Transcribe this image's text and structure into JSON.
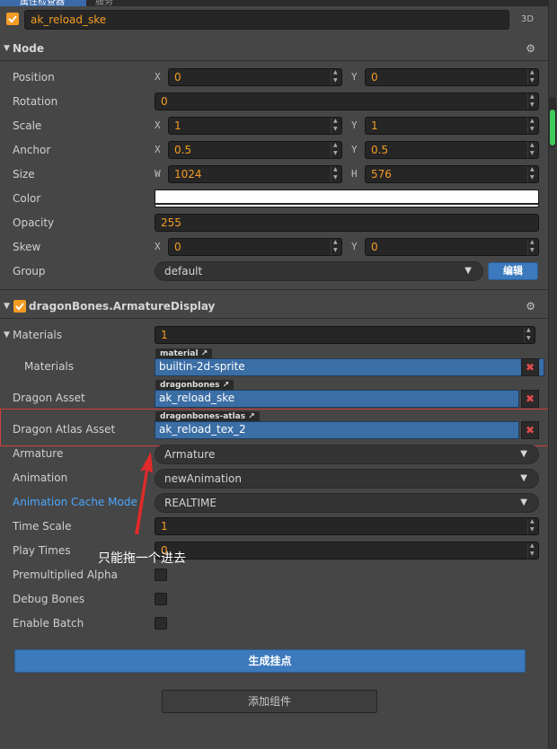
{
  "tabs": {
    "properties": "属性检查器",
    "other": "服务"
  },
  "node_name": "ak_reload_ske",
  "label_3d": "3D",
  "node_section": {
    "title": "Node",
    "position": {
      "label": "Position",
      "x_axis": "X",
      "x": "0",
      "y_axis": "Y",
      "y": "0"
    },
    "rotation": {
      "label": "Rotation",
      "value": "0"
    },
    "scale": {
      "label": "Scale",
      "x_axis": "X",
      "x": "1",
      "y_axis": "Y",
      "y": "1"
    },
    "anchor": {
      "label": "Anchor",
      "x_axis": "X",
      "x": "0.5",
      "y_axis": "Y",
      "y": "0.5"
    },
    "size": {
      "label": "Size",
      "w_axis": "W",
      "w": "1024",
      "h_axis": "H",
      "h": "576"
    },
    "color": {
      "label": "Color",
      "value": "#ffffff"
    },
    "opacity": {
      "label": "Opacity",
      "value": "255"
    },
    "skew": {
      "label": "Skew",
      "x_axis": "X",
      "x": "0",
      "y_axis": "Y",
      "y": "0"
    },
    "group": {
      "label": "Group",
      "value": "default",
      "edit_label": "编辑"
    }
  },
  "armature_section": {
    "title": "dragonBones.ArmatureDisplay",
    "materials_count": {
      "label": "Materials",
      "value": "1"
    },
    "materials_item": {
      "label": "Materials",
      "tag": "material",
      "value": "builtin-2d-sprite"
    },
    "dragon_asset": {
      "label": "Dragon Asset",
      "tag": "dragonbones",
      "value": "ak_reload_ske"
    },
    "dragon_atlas": {
      "label": "Dragon Atlas Asset",
      "tag": "dragonbones-atlas",
      "value": "ak_reload_tex_2"
    },
    "armature": {
      "label": "Armature",
      "value": "Armature"
    },
    "animation": {
      "label": "Animation",
      "value": "newAnimation"
    },
    "cache_mode": {
      "label": "Animation Cache Mode",
      "value": "REALTIME"
    },
    "time_scale": {
      "label": "Time Scale",
      "value": "1"
    },
    "play_times": {
      "label": "Play Times",
      "value": "0"
    },
    "premultiplied": {
      "label": "Premultiplied Alpha"
    },
    "debug_bones": {
      "label": "Debug Bones"
    },
    "enable_batch": {
      "label": "Enable Batch"
    }
  },
  "buttons": {
    "generate": "生成挂点",
    "add_component": "添加组件"
  },
  "annotation": "只能拖一个进去",
  "colors": {
    "accent": "#f39c24",
    "blue": "#3c79bd",
    "highlight": "#d23c3c",
    "label_blue": "#4da6ff"
  }
}
